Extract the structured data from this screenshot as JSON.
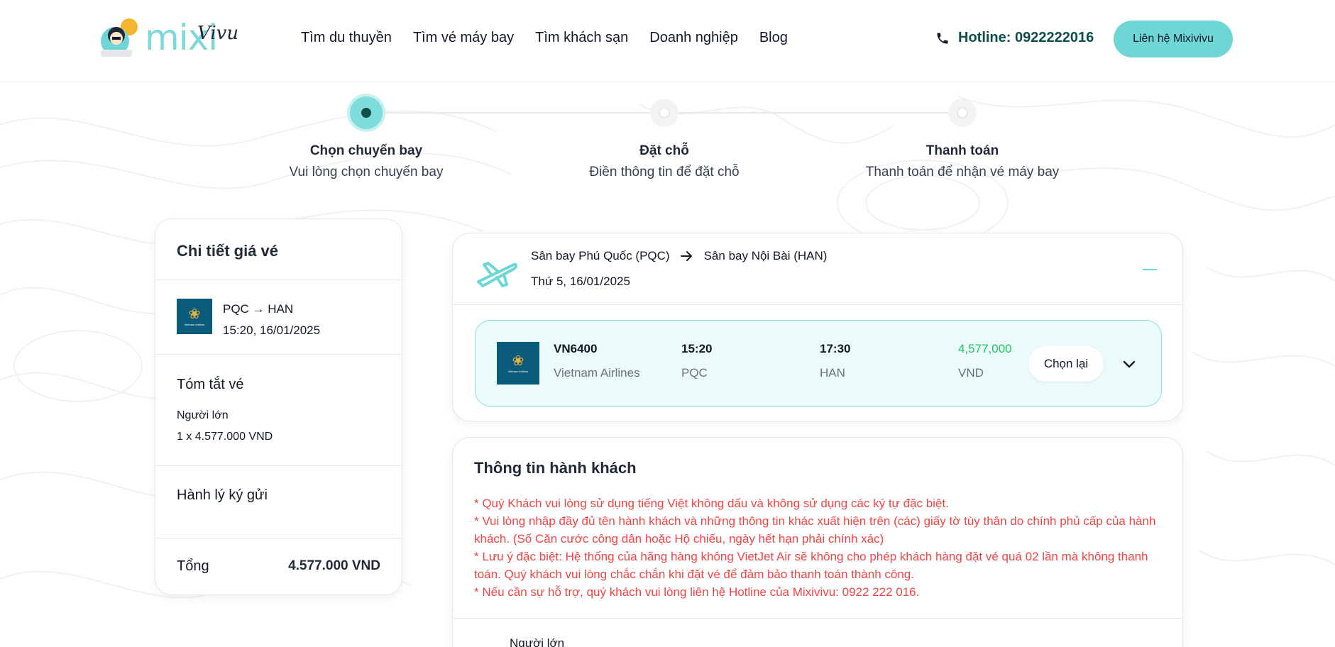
{
  "brand": {
    "logo_text": "mixi",
    "logo_script": "Vivu"
  },
  "nav": {
    "items": [
      "Tìm du thuyền",
      "Tìm vé máy bay",
      "Tìm khách sạn",
      "Doanh nghiệp",
      "Blog"
    ]
  },
  "header": {
    "hotline_label": "Hotline: 0922222016",
    "contact_button": "Liên hệ Mixivivu"
  },
  "stepper": {
    "steps": [
      {
        "title": "Chọn chuyến bay",
        "subtitle": "Vui lòng chọn chuyến bay",
        "state": "active"
      },
      {
        "title": "Đặt chỗ",
        "subtitle": "Điền thông tin để đặt chỗ",
        "state": "pending"
      },
      {
        "title": "Thanh toán",
        "subtitle": "Thanh toán để nhận vé máy bay",
        "state": "pending"
      }
    ]
  },
  "price_detail": {
    "title": "Chi tiết giá vé",
    "route": "PQC → HAN",
    "datetime": "15:20, 16/01/2025",
    "summary_title": "Tóm tắt vé",
    "passenger_type": "Người lớn",
    "passenger_price": "1 x 4.577.000 VND",
    "baggage_title": "Hành lý ký gửi",
    "total_label": "Tổng",
    "total_value": "4.577.000 VND"
  },
  "flight": {
    "from_airport": "Sân bay Phú Quốc (PQC)",
    "to_airport": "Sân bay Nội Bài (HAN)",
    "date": "Thứ 5, 16/01/2025",
    "number": "VN6400",
    "airline": "Vietnam Airlines",
    "depart_time": "15:20",
    "depart_code": "PQC",
    "arrive_time": "17:30",
    "arrive_code": "HAN",
    "price": "4,577,000",
    "currency": "VND",
    "reselect_button": "Chọn lại"
  },
  "passenger_info": {
    "title": "Thông tin hành khách",
    "notes": [
      "* Quý Khách vui lòng sử dụng tiếng Việt không dấu và không sử dụng các ký tự đặc biệt.",
      "* Vui lòng nhập đầy đủ tên hành khách và những thông tin khác xuất hiện trên (các) giấy tờ tùy thân do chính phủ cấp của hành khách. (Số Căn cước công dân hoặc Hộ chiếu, ngày hết hạn phải chính xác)",
      "* Lưu ý đặc biệt: Hệ thống của hãng hàng không VietJet Air sẽ không cho phép khách hàng đặt vé quá 02 lần mà không thanh toán. Quý khách vui lòng chắc chắn khi đặt vé để đảm bảo thanh toán thành công.",
      "* Nếu cần sự hỗ trợ, quý khách vui lòng liên hệ Hotline của Mixivivu: 0922 222 016."
    ],
    "adult_label": "Người lớn"
  },
  "colors": {
    "accent": "#6fd6d6",
    "price_green": "#22c55e",
    "warning_red": "#ef4444",
    "airline_blue": "#0b5c7a"
  }
}
